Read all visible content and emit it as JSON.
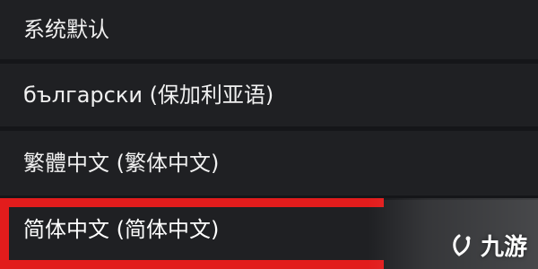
{
  "languages": {
    "items": [
      {
        "label": "系统默认"
      },
      {
        "label": "български (保加利亚语)"
      },
      {
        "label": "繁體中文 (繁体中文)"
      },
      {
        "label": "简体中文 (简体中文)"
      }
    ],
    "selected_index": 3
  },
  "watermark": {
    "text": "九游",
    "icon": "jiuyou-logo-icon"
  },
  "colors": {
    "background": "#1f2023",
    "text": "#f0f0f0",
    "highlight_border": "#e21c1c"
  }
}
